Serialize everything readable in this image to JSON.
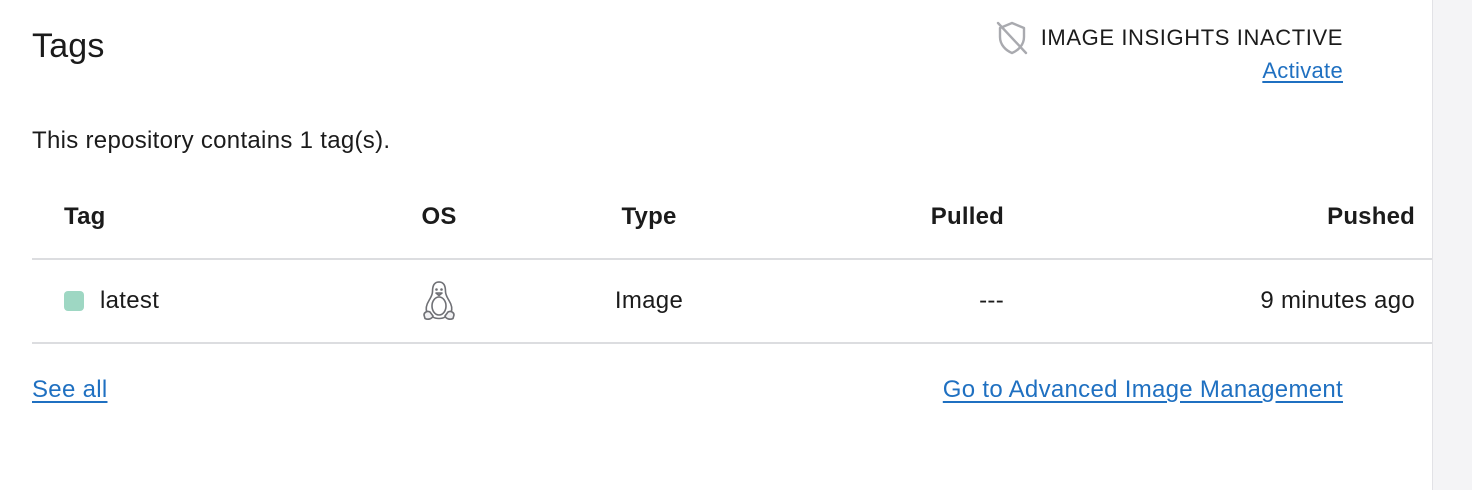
{
  "section": {
    "title": "Tags",
    "description": "This repository contains 1 tag(s)."
  },
  "insights": {
    "status_text": "IMAGE INSIGHTS INACTIVE",
    "activate_label": "Activate",
    "icon": "shield-off-icon"
  },
  "table": {
    "headers": {
      "tag": "Tag",
      "os": "OS",
      "type": "Type",
      "pulled": "Pulled",
      "pushed": "Pushed"
    },
    "rows": [
      {
        "tag": "latest",
        "status_color": "#9ed7c3",
        "os_icon": "linux-icon",
        "type": "Image",
        "pulled": "---",
        "pushed": "9 minutes ago"
      }
    ]
  },
  "footer": {
    "see_all_label": "See all",
    "advanced_label": "Go to Advanced Image Management"
  },
  "colors": {
    "link": "#1f70c1",
    "divider": "#dcdde0",
    "status_active": "#9ed7c3"
  }
}
